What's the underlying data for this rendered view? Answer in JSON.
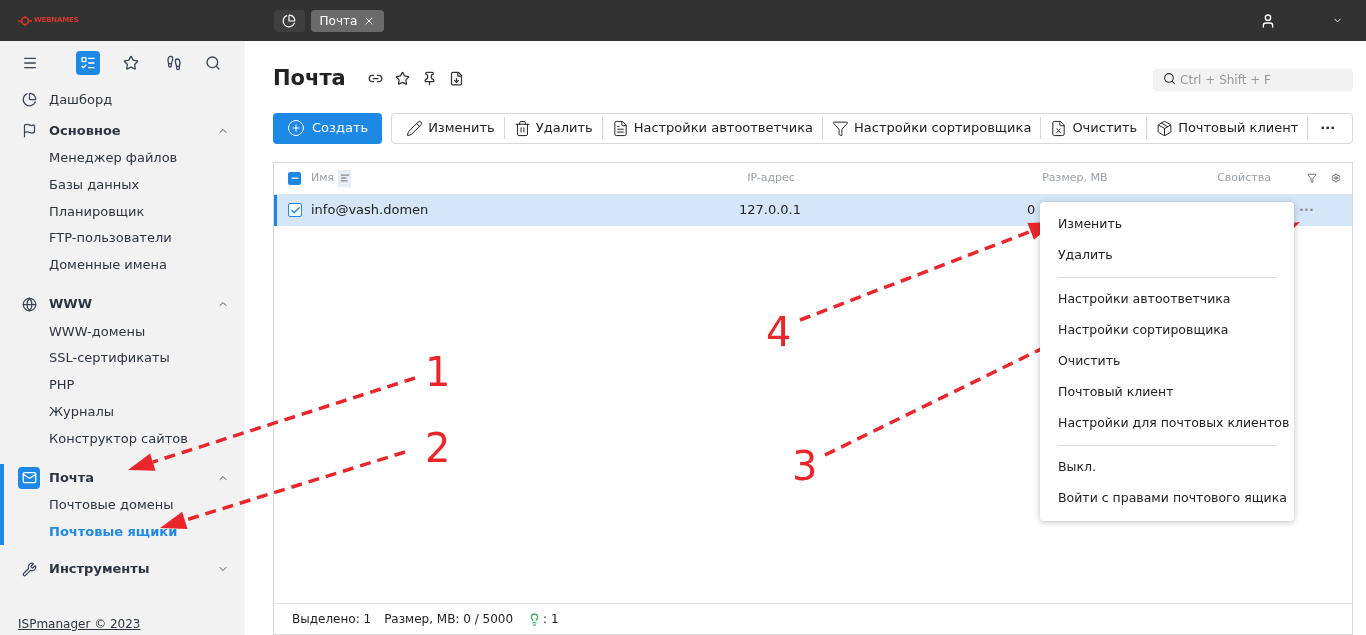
{
  "header": {
    "logo": "WEBNAMES",
    "tabs": [
      {
        "kind": "icon",
        "selected": false
      },
      {
        "kind": "text",
        "label": "Почта",
        "selected": true
      }
    ]
  },
  "sidebar": {
    "tools": [
      {
        "selected": true
      },
      {
        "selected": false
      },
      {
        "selected": false
      },
      {
        "selected": false
      }
    ],
    "items": [
      {
        "label": "Дашборд",
        "selected": false
      },
      {
        "label": "Основное",
        "selected": false,
        "expanded": true,
        "children": [
          {
            "label": "Менеджер файлов",
            "selected": false
          },
          {
            "label": "Базы данных",
            "selected": false
          },
          {
            "label": "Планировщик",
            "selected": false
          },
          {
            "label": "FTP-пользователи",
            "selected": false
          },
          {
            "label": "Доменные имена",
            "selected": false
          }
        ]
      },
      {
        "label": "WWW",
        "selected": false,
        "expanded": true,
        "children": [
          {
            "label": "WWW-домены",
            "selected": false
          },
          {
            "label": "SSL-сертификаты",
            "selected": false
          },
          {
            "label": "PHP",
            "selected": false
          },
          {
            "label": "Журналы",
            "selected": false
          },
          {
            "label": "Конструктор сайтов",
            "selected": false
          }
        ]
      },
      {
        "label": "Почта",
        "selected": true,
        "expanded": true,
        "children": [
          {
            "label": "Почтовые домены",
            "selected": false
          },
          {
            "label": "Почтовые ящики",
            "selected": true
          }
        ]
      },
      {
        "label": "Инструменты",
        "selected": false,
        "expanded": false
      }
    ],
    "footer": "ISPmanager © 2023"
  },
  "page": {
    "title": "Почта",
    "search": {
      "placeholder": "Ctrl + Shift + F"
    }
  },
  "toolbar": [
    {
      "label": "Создать",
      "kind": "primary"
    },
    {
      "label": "Изменить",
      "kind": "plain"
    },
    {
      "label": "Удалить",
      "kind": "plain"
    },
    {
      "label": "Настройки автоответчика",
      "kind": "plain"
    },
    {
      "label": "Настройки сортировщика",
      "kind": "plain"
    },
    {
      "label": "Очистить",
      "kind": "plain"
    },
    {
      "label": "Почтовый клиент",
      "kind": "plain"
    },
    {
      "label": "···",
      "kind": "more"
    }
  ],
  "table": {
    "some_checked": true,
    "columns": [
      "Имя",
      "IP-адрес",
      "Размер, MB",
      "Свойства"
    ],
    "rows": [
      {
        "name": "info@vash.domen",
        "ip": "127.0.0.1",
        "size": "0",
        "more": "···",
        "selected": true,
        "checked": true
      }
    ]
  },
  "context_menu": [
    [
      {
        "label": "Изменить"
      },
      {
        "label": "Удалить"
      }
    ],
    [
      {
        "label": "Настройки автоответчика"
      },
      {
        "label": "Настройки сортировщика"
      },
      {
        "label": "Очистить"
      },
      {
        "label": "Почтовый клиент"
      },
      {
        "label": "Настройки для почтовых клиентов"
      }
    ],
    [
      {
        "label": "Выкл."
      },
      {
        "label": "Войти с правами почтового ящика"
      }
    ]
  ],
  "status_bar": {
    "selected": "Выделено: 1",
    "size": "Размер, MB: 0 / 5000",
    "active": ": 1"
  },
  "annotations": [
    "1",
    "2",
    "3",
    "4"
  ]
}
